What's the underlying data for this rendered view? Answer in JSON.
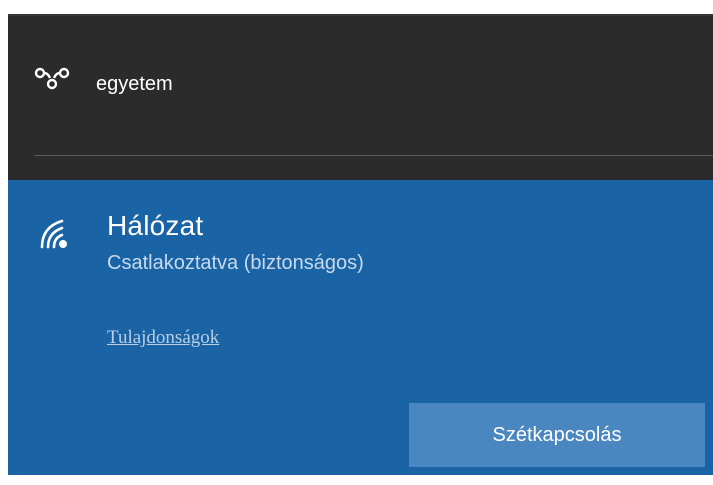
{
  "vpn": {
    "icon": "vpn-link-icon",
    "name": "egyetem"
  },
  "wifi": {
    "icon": "wifi-signal-icon",
    "name": "Hálózat",
    "status": "Csatlakoztatva (biztonságos)",
    "properties_link": "Tulajdonságok",
    "disconnect_label": "Szétkapcsolás"
  },
  "colors": {
    "panel_background": "#2b2b2b",
    "selected_background": "#1a64a6",
    "button_background": "#4a87c0",
    "text_primary": "#ffffff"
  }
}
